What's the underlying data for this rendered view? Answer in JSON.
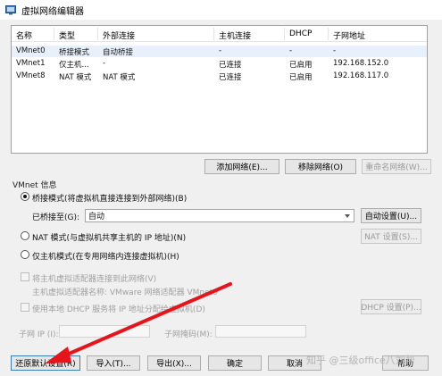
{
  "window": {
    "title": "虚拟网络编辑器"
  },
  "table": {
    "headers": [
      "名称",
      "类型",
      "外部连接",
      "主机连接",
      "DHCP",
      "子网地址"
    ],
    "rows": [
      [
        "VMnet0",
        "桥接模式",
        "自动桥接",
        "-",
        "-",
        "-"
      ],
      [
        "VMnet1",
        "仅主机...",
        "-",
        "已连接",
        "已启用",
        "192.168.152.0"
      ],
      [
        "VMnet8",
        "NAT 模式",
        "NAT 模式",
        "已连接",
        "已启用",
        "192.168.117.0"
      ]
    ]
  },
  "table_buttons": {
    "add": "添加网络(E)...",
    "remove": "移除网络(O)",
    "rename": "重命名网络(W)..."
  },
  "vmnet_info": {
    "label": "VMnet 信息",
    "bridge_option": "桥接模式(将虚拟机直接连接到外部网络)(B)",
    "bridged_to_label": "已桥接至(G):",
    "bridged_to_value": "自动",
    "auto_settings": "自动设置(U)...",
    "nat_option": "NAT 模式(与虚拟机共享主机的 IP 地址)(N)",
    "nat_settings": "NAT 设置(S)...",
    "hostonly_option": "仅主机模式(在专用网络内连接虚拟机)(H)",
    "connect_adapter": "将主机虚拟适配器连接到此网络(V)",
    "adapter_name": "主机虚拟适配器名称: VMware 网络适配器 VMnet0",
    "use_dhcp": "使用本地 DHCP 服务将 IP 地址分配给虚拟机(D)",
    "dhcp_settings": "DHCP 设置(P)...",
    "subnet_ip_label": "子网 IP (I):",
    "subnet_mask_label": "子网掩码(M):"
  },
  "footer": {
    "restore": "还原默认设置(R)",
    "import": "导入(T)...",
    "export": "导出(X)...",
    "ok": "确定",
    "cancel": "取消",
    "help": "帮助"
  },
  "watermark": "知乎 @三级office八刘帮",
  "colors": {
    "annotation_arrow": "#e8141b",
    "selected_row": "#e8f1fb"
  }
}
